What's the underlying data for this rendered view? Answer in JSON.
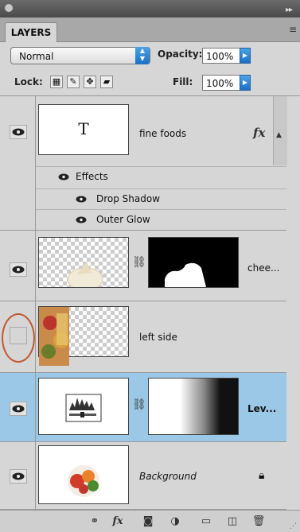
{
  "panel": {
    "tab_label": "LAYERS",
    "blend_mode": "Normal",
    "opacity_label": "Opacity:",
    "opacity_value": "100%",
    "lock_label": "Lock:",
    "fill_label": "Fill:",
    "fill_value": "100%"
  },
  "layers": [
    {
      "name": "fine foods",
      "type_glyph": "T",
      "fx": "fx",
      "visible": true,
      "effects_label": "Effects",
      "effects": [
        "Drop Shadow",
        "Outer Glow"
      ]
    },
    {
      "name": "chee...",
      "visible": true
    },
    {
      "name": "left side",
      "visible": false
    },
    {
      "name": "Lev...",
      "visible": true,
      "selected": true
    },
    {
      "name": "Background",
      "visible": true,
      "locked": true
    }
  ],
  "toolbar": {
    "link": "link-layers",
    "fx": "fx",
    "mask": "add-mask",
    "adjust": "new-adjustment",
    "group": "new-group",
    "new": "new-layer",
    "trash": "delete-layer"
  },
  "colors": {
    "selected": "#9cc8e8",
    "accent": "#1c6fc4",
    "annotation": "#c0572f"
  }
}
